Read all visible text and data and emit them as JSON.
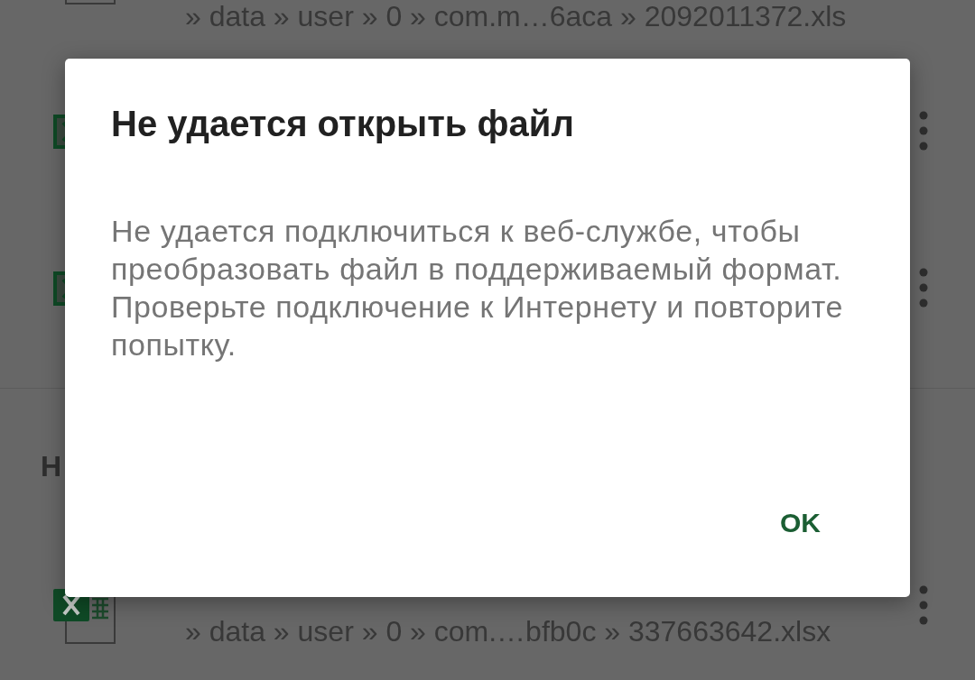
{
  "file_list": [
    {
      "kind": "xls_file",
      "path": "» data » user » 0 » com.m…6aca » 2092011372.xls",
      "more_button": false
    },
    {
      "kind": "xls_file",
      "more_button": true
    },
    {
      "kind": "xls_file",
      "more_button": true
    },
    {
      "kind": "header",
      "label": "Н"
    },
    {
      "kind": "xlsx_file",
      "path": "» data » user » 0 » com.…bfb0c » 337663642.xlsx",
      "more_button": true
    }
  ],
  "dialog": {
    "title": "Не удается открыть файл",
    "message": "Не удается подключиться к веб-службе, чтобы преобразовать файл в поддерживаемый формат. Проверьте подключение к Интернету и повторите попытку.",
    "buttons": [
      "OK"
    ]
  }
}
